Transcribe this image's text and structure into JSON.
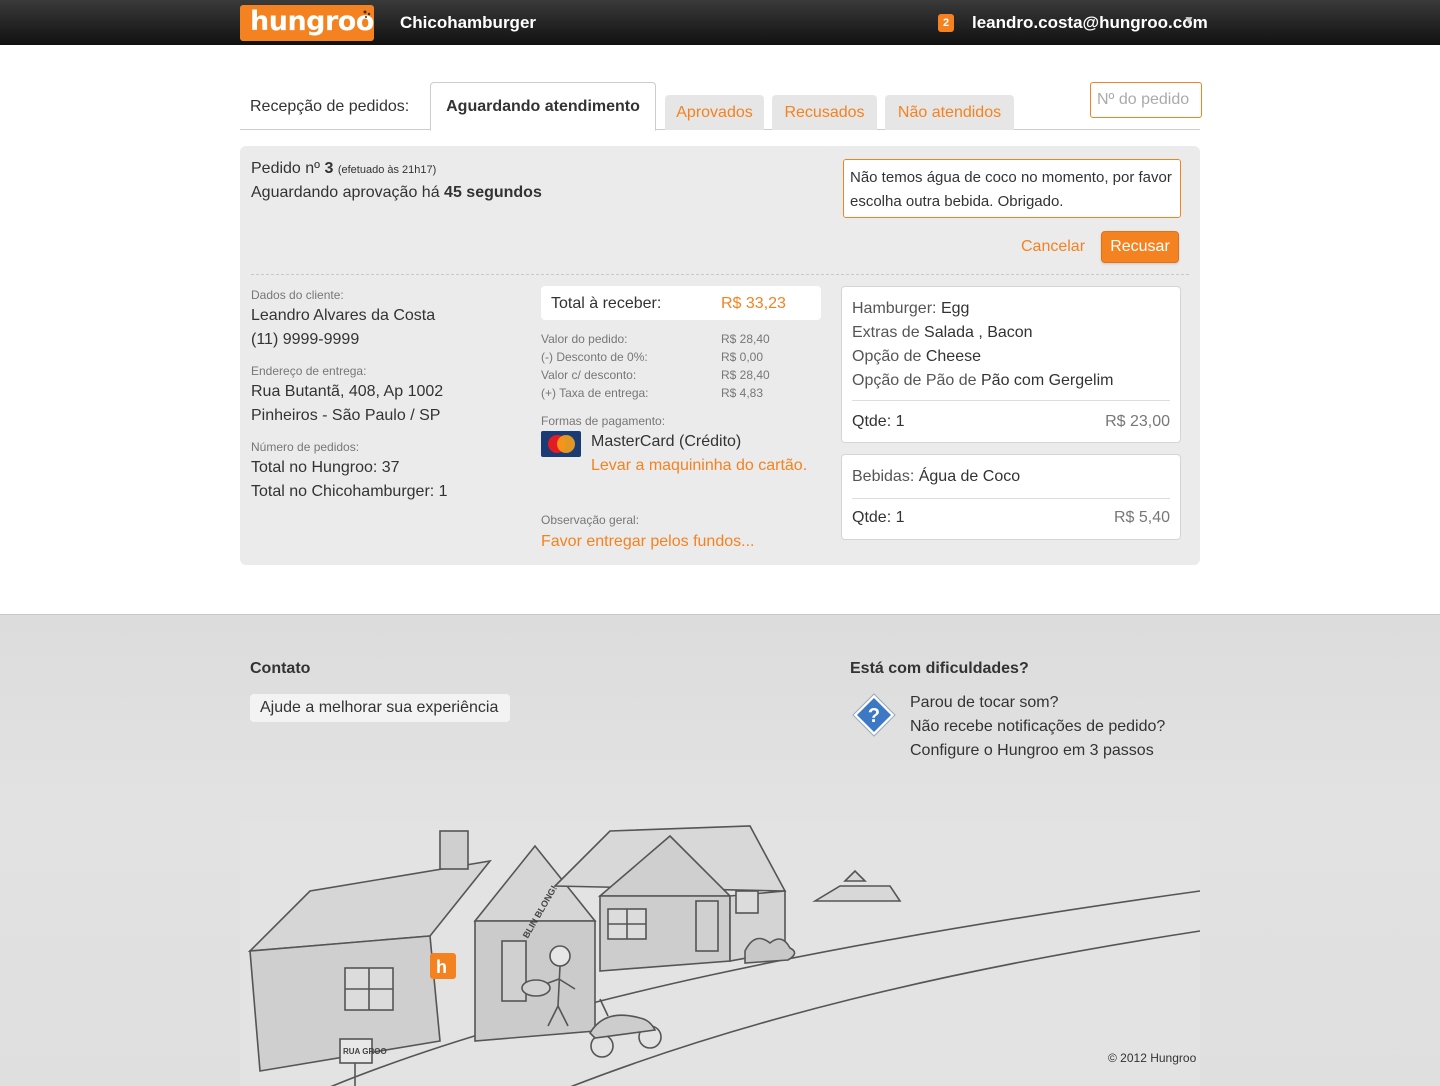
{
  "topbar": {
    "logo": "hungroo",
    "store_name": "Chicohamburger",
    "notification_count": "2",
    "user_email": "leandro.costa@hungroo.com",
    "caret": "▼"
  },
  "tabs": {
    "label": "Recepção de pedidos:",
    "active": "Aguardando atendimento",
    "items": [
      "Aprovados",
      "Recusados",
      "Não atendidos"
    ],
    "search_placeholder": "Nº do pedido"
  },
  "order": {
    "title_prefix": "Pedido nº",
    "number": "3",
    "placed_at": "(efetuado às 21h17)",
    "wait_prefix": "Aguardando aprovação há",
    "wait_time": "45 segundos",
    "reject_note": "Não temos água de coco no momento, por favor escolha outra bebida. Obrigado.",
    "cancel_label": "Cancelar",
    "reject_label": "Recusar"
  },
  "client": {
    "label": "Dados do cliente:",
    "name": "Leandro Alvares da Costa",
    "phone": "(11) 9999-9999",
    "address_label": "Endereço de entrega:",
    "address_line1": "Rua Butantã, 408, Ap 1002",
    "address_line2": "Pinheiros - São Paulo / SP",
    "orders_label": "Número de pedidos:",
    "orders_hungroo": "Total no Hungroo: 37",
    "orders_store": "Total no Chicohamburger: 1"
  },
  "summary": {
    "total_label": "Total à receber:",
    "total_value": "R$ 33,23",
    "rows": [
      {
        "label": "Valor do pedido:",
        "value": "R$ 28,40"
      },
      {
        "label": "(-) Desconto de 0%:",
        "value": "R$ 0,00"
      },
      {
        "label": "Valor c/ desconto:",
        "value": "R$ 28,40"
      },
      {
        "label": "(+) Taxa de entrega:",
        "value": "R$ 4,83"
      }
    ],
    "payment_label": "Formas de pagamento:",
    "payment_method": "MasterCard (Crédito)",
    "payment_note": "Levar a maquininha do cartão.",
    "obs_label": "Observação geral:",
    "obs_text": "Favor entregar pelos fundos..."
  },
  "items": [
    {
      "lines": [
        {
          "cat": "Hamburger:",
          "val": "Egg"
        },
        {
          "cat": "Extras de",
          "val": "Salada , Bacon"
        },
        {
          "cat": "Opção de",
          "val": "Cheese"
        },
        {
          "cat": "Opção de Pão de",
          "val": "Pão com Gergelim"
        }
      ],
      "qty": "Qtde: 1",
      "price": "R$ 23,00"
    },
    {
      "lines": [
        {
          "cat": "Bebidas:",
          "val": "Água de Coco"
        }
      ],
      "qty": "Qtde: 1",
      "price": "R$ 5,40"
    }
  ],
  "footer": {
    "contact_title": "Contato",
    "contact_button": "Ajude a melhorar sua experiência",
    "help_title": "Está com dificuldades?",
    "help_line1": "Parou de tocar som?",
    "help_line2": "Não recebe notificações de pedido?",
    "help_link": "Configure o Hungroo em 3 passos",
    "copyright": "© 2012 Hungroo",
    "illustration_texts": [
      "BLIN BLONG!",
      "RUA GROO"
    ]
  }
}
